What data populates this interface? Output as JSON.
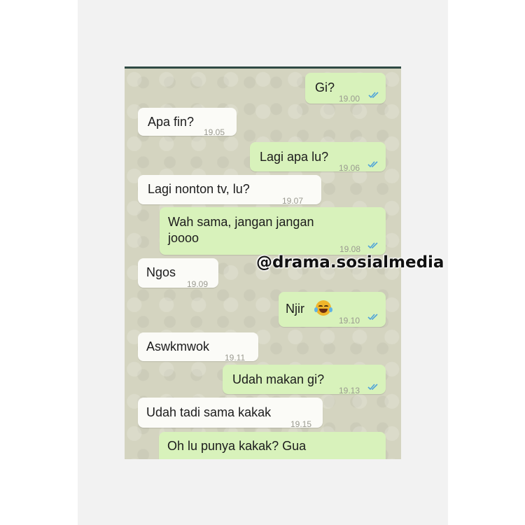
{
  "watermark": "@drama.sosialmedia",
  "messages": [
    {
      "dir": "out",
      "lines": [
        "Gi?"
      ],
      "time": "19.00",
      "read": true
    },
    {
      "dir": "in",
      "lines": [
        "Apa fin?"
      ],
      "time": "19.05"
    },
    {
      "dir": "out",
      "lines": [
        "Lagi apa lu?"
      ],
      "time": "19.06",
      "read": true
    },
    {
      "dir": "in",
      "lines": [
        "Lagi nonton tv, lu?"
      ],
      "time": "19.07"
    },
    {
      "dir": "out",
      "lines": [
        "Wah sama, jangan jangan",
        "joooo"
      ],
      "time": "19.08",
      "read": true
    },
    {
      "dir": "in",
      "lines": [
        "Ngos"
      ],
      "time": "19.09"
    },
    {
      "dir": "out",
      "lines": [
        "Njir"
      ],
      "emoji": "laughing-with-tears",
      "time": "19.10",
      "read": true
    },
    {
      "dir": "in",
      "lines": [
        "Aswkmwok"
      ],
      "time": "19.11"
    },
    {
      "dir": "out",
      "lines": [
        "Udah makan gi?"
      ],
      "time": "19.13",
      "read": true
    },
    {
      "dir": "in",
      "lines": [
        "Udah tadi sama kakak"
      ],
      "time": "19.15"
    },
    {
      "dir": "out",
      "lines": [
        "Oh lu punya kakak? Gua"
      ],
      "time": "",
      "read": false
    }
  ],
  "colors": {
    "bubble_out": "#d8f2bb",
    "bubble_in": "#fbfbf7",
    "chat_bg": "#d4d4c0",
    "tick": "#4fa3d9"
  }
}
